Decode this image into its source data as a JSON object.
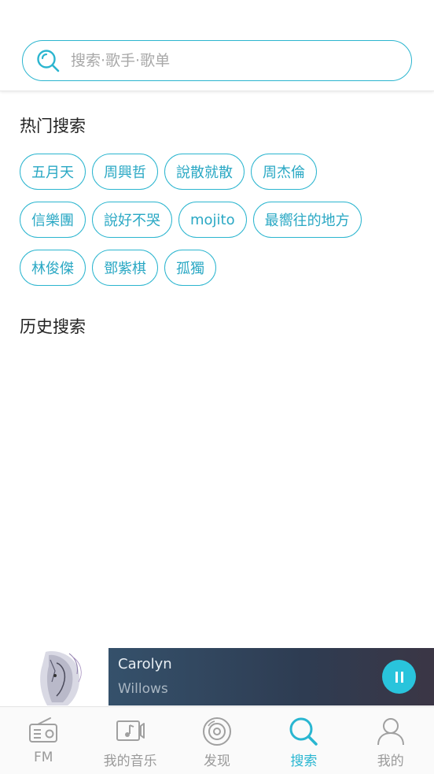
{
  "search": {
    "placeholder": "搜索·歌手·歌单"
  },
  "hot": {
    "title": "热门搜索",
    "rows": [
      [
        "五月天",
        "周興哲",
        "說散就散",
        "周杰倫"
      ],
      [
        "信樂團",
        "說好不哭",
        "mojito",
        "最嚮往的地方"
      ],
      [
        "林俊傑",
        "鄧紫棋",
        "孤獨"
      ]
    ]
  },
  "history": {
    "title": "历史搜索"
  },
  "player": {
    "title": "Carolyn",
    "artist": "Willows"
  },
  "tabs": [
    {
      "label": "FM",
      "icon": "radio-icon"
    },
    {
      "label": "我的音乐",
      "icon": "music-note-icon"
    },
    {
      "label": "发现",
      "icon": "disc-icon"
    },
    {
      "label": "搜索",
      "icon": "search-icon"
    },
    {
      "label": "我的",
      "icon": "user-icon"
    }
  ],
  "colors": {
    "accent": "#2bb5cf",
    "tab_inactive": "#9a9a9a",
    "player_bg": "#2e3c52"
  }
}
